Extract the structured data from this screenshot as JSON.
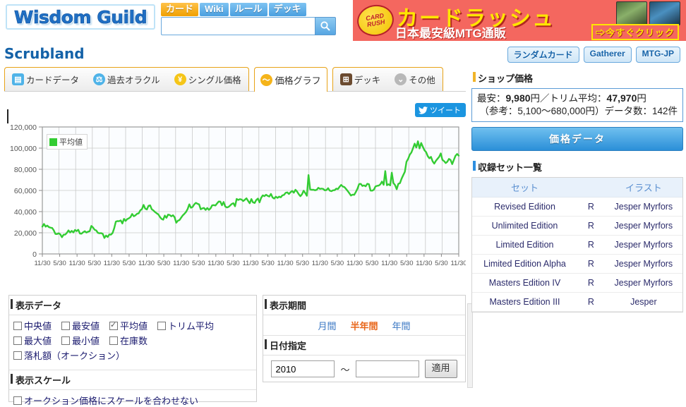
{
  "header": {
    "logo_text": "Wisdom Guild",
    "nav_tabs": [
      {
        "label": "カード",
        "state": "active"
      },
      {
        "label": "Wiki",
        "state": "normal"
      },
      {
        "label": "ルール",
        "state": "normal"
      },
      {
        "label": "デッキ",
        "state": "normal"
      }
    ],
    "search": {
      "value": "",
      "placeholder": "",
      "icon": "search-icon"
    }
  },
  "ad": {
    "badge_line1": "CARD",
    "badge_line2": "RUSH",
    "headline": "カードラッシュ",
    "subline": "日本最安級MTG通販",
    "cta": "⇨今すぐクリック"
  },
  "page": {
    "card_title": "Scrubland",
    "top_buttons": [
      {
        "label": "ランダムカード"
      },
      {
        "label": "Gatherer"
      },
      {
        "label": "MTG-JP"
      }
    ]
  },
  "tabs": {
    "group1": [
      {
        "label": "カードデータ",
        "icon": "card-data-icon",
        "glyph": "▤",
        "active": false
      },
      {
        "label": "過去オラクル",
        "icon": "oracle-scales-icon",
        "glyph": "⚖",
        "active": false
      },
      {
        "label": "シングル価格",
        "icon": "yen-icon",
        "glyph": "¥",
        "active": false
      }
    ],
    "active_tab": {
      "label": "価格グラフ",
      "icon": "price-graph-icon",
      "glyph": "〜",
      "active": true
    },
    "group2": [
      {
        "label": "デッキ",
        "icon": "deck-grid-icon",
        "glyph": "⊞",
        "active": false
      },
      {
        "label": "その他",
        "icon": "chevron-down-icon",
        "glyph": "⌄",
        "active": false
      }
    ]
  },
  "share": {
    "tweet_label": "ツイート",
    "icon": "twitter-bird-icon"
  },
  "chart_data": {
    "type": "line",
    "title": "",
    "xlabel": "",
    "ylabel": "",
    "ylim": [
      0,
      120000
    ],
    "ytick_labels": [
      "0",
      "20,000",
      "40,000",
      "60,000",
      "80,000",
      "100,000",
      "120,000"
    ],
    "ytick_values": [
      0,
      20000,
      40000,
      60000,
      80000,
      100000,
      120000
    ],
    "grid": true,
    "legend_position": "upper-left",
    "legend": [
      "平均値"
    ],
    "series": [
      {
        "name": "平均値",
        "color": "#33cc33",
        "values": [
          25800,
          25200,
          25600,
          24900,
          24100,
          23300,
          22400,
          21700,
          21200,
          20400,
          19600,
          19100,
          18600,
          18200,
          18900,
          18400,
          19100,
          18800,
          19600,
          19200,
          20100,
          19700,
          20600,
          21300,
          22100,
          22800,
          23200,
          23600,
          23900,
          23500,
          23100,
          22600,
          21900,
          20800,
          19300,
          17600,
          16400,
          15800,
          16900,
          18200,
          17400,
          18600,
          20100,
          22400,
          25300,
          27800,
          30100,
          29200,
          31200,
          28400,
          32100,
          30800,
          33600,
          35200,
          36900,
          38200,
          37400,
          39100,
          40300,
          41200,
          40600,
          42100,
          43600,
          42800,
          41700,
          45200,
          43900,
          44800,
          43200,
          41900,
          40600,
          39100,
          37800,
          36400,
          35100,
          34200,
          33600,
          34800,
          36200,
          35400,
          34100,
          33200,
          32600,
          33900,
          35100,
          36400,
          38200,
          40100,
          41600,
          42800,
          44100,
          43200,
          42600,
          44300,
          45600,
          44900,
          43700,
          45100,
          46300,
          45200,
          44100,
          43600,
          44800,
          45900,
          44300,
          43100,
          44600,
          45800,
          47100,
          46200,
          45300,
          46900,
          48100,
          47200,
          46100,
          47600,
          49100,
          48200,
          47100,
          48600,
          50100,
          49200,
          48100,
          49600,
          51200,
          50100,
          49100,
          50600,
          52100,
          51200,
          50100,
          51600,
          53100,
          52100,
          51100,
          52600,
          54100,
          53200,
          52100,
          53600,
          55200,
          54100,
          53100,
          54600,
          56100,
          55100,
          54100,
          55600,
          57200,
          56100,
          55100,
          56600,
          58100,
          57100,
          56100,
          57600,
          59100,
          58100,
          57100,
          58600,
          60100,
          59100,
          58100,
          76200,
          60400,
          59100,
          58200,
          57600,
          58900,
          60200,
          61400,
          62700,
          61900,
          60800,
          62100,
          63400,
          62600,
          61400,
          60200,
          59100,
          58400,
          59700,
          61100,
          62400,
          63700,
          62900,
          61700,
          60400,
          59200,
          58100,
          57400,
          58700,
          60100,
          61400,
          62700,
          64100,
          63200,
          62100,
          63400,
          64700,
          63900,
          62700,
          61400,
          62800,
          64200,
          65600,
          67100,
          66200,
          65100,
          63900,
          77400,
          64200,
          63100,
          62100,
          74800,
          66200,
          65100,
          64200,
          66700,
          69100,
          72400,
          76200,
          80100,
          84600,
          88200,
          92100,
          95600,
          98200,
          101400,
          99200,
          103600,
          101200,
          105800,
          103400,
          100200,
          97600,
          95100,
          92400,
          89600,
          86200,
          83100,
          85600,
          88200,
          91400,
          93800,
          91200,
          88600,
          86100,
          88700,
          91200,
          89600,
          87200,
          90100,
          92600,
          91100,
          89600
        ]
      }
    ],
    "xtick_labels": [
      "11/30",
      "5/30",
      "11/30",
      "5/30",
      "11/30",
      "5/30",
      "11/30",
      "5/30",
      "11/30",
      "5/30",
      "11/30",
      "5/30",
      "11/30",
      "5/30",
      "11/30",
      "5/30",
      "11/30",
      "5/30",
      "11/30",
      "5/30",
      "11/30",
      "5/30",
      "11/30",
      "5/30",
      "11/30"
    ]
  },
  "display_data_panel": {
    "title": "表示データ",
    "checkboxes": [
      {
        "label": "中央値",
        "checked": false
      },
      {
        "label": "最安値",
        "checked": false
      },
      {
        "label": "平均値",
        "checked": true
      },
      {
        "label": "トリム平均",
        "checked": false
      },
      {
        "label": "最大値",
        "checked": false
      },
      {
        "label": "最小値",
        "checked": false
      },
      {
        "label": "在庫数",
        "checked": false
      },
      {
        "label": "落札額（オークション）",
        "checked": false
      }
    ],
    "scale_title": "表示スケール",
    "scale_checkbox": {
      "label": "オークション価格にスケールを合わせない",
      "checked": false
    }
  },
  "period_panel": {
    "title": "表示期間",
    "options": [
      {
        "label": "月間",
        "selected": false
      },
      {
        "label": "半年間",
        "selected": true
      },
      {
        "label": "年間",
        "selected": false
      }
    ],
    "date_title": "日付指定",
    "date_from": "2010",
    "date_to": "",
    "range_separator": "～",
    "apply_label": "適用"
  },
  "sidebar": {
    "shop_price": {
      "title": "ショップ価格",
      "line1_prefix": "最安：",
      "line1_min": "9,980",
      "line1_mid": "円／トリム平均：",
      "line1_avg": "47,970",
      "line1_suffix": "円",
      "line2": "（参考：5,100～680,000円）データ数：142件",
      "data_button": "価格データ"
    },
    "set_list": {
      "title": "収録セット一覧",
      "columns": [
        "セット",
        "",
        "イラスト"
      ],
      "rows": [
        {
          "set": "Revised Edition",
          "rarity": "R",
          "artist": "Jesper Myrfors"
        },
        {
          "set": "Unlimited Edition",
          "rarity": "R",
          "artist": "Jesper Myrfors"
        },
        {
          "set": "Limited Edition",
          "rarity": "R",
          "artist": "Jesper Myrfors"
        },
        {
          "set": "Limited Edition Alpha",
          "rarity": "R",
          "artist": "Jesper Myrfors"
        },
        {
          "set": "Masters Edition IV",
          "rarity": "R",
          "artist": "Jesper Myrfors"
        },
        {
          "set": "Masters Edition III",
          "rarity": "R",
          "artist": "Jesper"
        }
      ]
    }
  },
  "colors": {
    "brand_blue": "#1462a8",
    "accent_orange": "#e8a317",
    "series_green": "#33cc33",
    "ad_red": "#f4675f"
  }
}
